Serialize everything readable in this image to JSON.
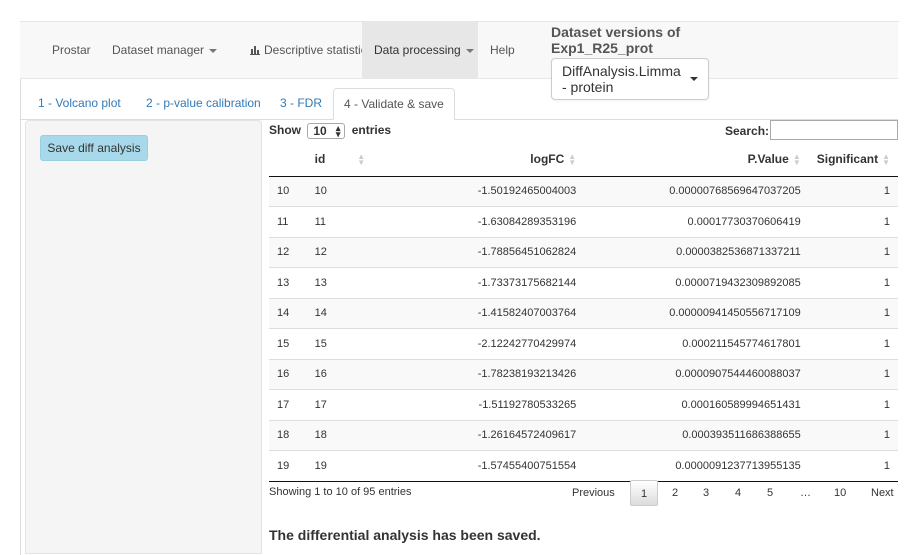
{
  "navbar": {
    "brand": "Prostar",
    "items": [
      "Dataset manager",
      "Descriptive statistics",
      "Data processing",
      "Help"
    ]
  },
  "dataset": {
    "title_line1": "Dataset versions of",
    "title_line2": "Exp1_R25_prot",
    "selected": "DiffAnalysis.Limma - protein"
  },
  "tabs": [
    "1 - Volcano plot",
    "2 - p-value calibration",
    "3 - FDR",
    "4 - Validate & save"
  ],
  "sidebar": {
    "save_button": "Save diff analysis"
  },
  "table": {
    "length_prefix": "Show",
    "length_value": "10",
    "length_suffix": "entries",
    "search_label": "Search:",
    "columns": [
      "",
      "id",
      "logFC",
      "P.Value",
      "Significant"
    ],
    "rows": [
      [
        "10",
        "10",
        "-1.50192465004003",
        "0.00000768569647037205",
        "1"
      ],
      [
        "11",
        "11",
        "-1.63084289353196",
        "0.00017730370606419",
        "1"
      ],
      [
        "12",
        "12",
        "-1.78856451062824",
        "0.0000382536871337211",
        "1"
      ],
      [
        "13",
        "13",
        "-1.73373175682144",
        "0.0000719432309892085",
        "1"
      ],
      [
        "14",
        "14",
        "-1.41582407003764",
        "0.00000941450556717109",
        "1"
      ],
      [
        "15",
        "15",
        "-2.12242770429974",
        "0.000211545774617801",
        "1"
      ],
      [
        "16",
        "16",
        "-1.78238193213426",
        "0.0000907544460088037",
        "1"
      ],
      [
        "17",
        "17",
        "-1.51192780533265",
        "0.000160589994651431",
        "1"
      ],
      [
        "18",
        "18",
        "-1.26164572409617",
        "0.000393511686388655",
        "1"
      ],
      [
        "19",
        "19",
        "-1.57455400751554",
        "0.0000091237713955135",
        "1"
      ]
    ],
    "info": "Showing 1 to 10 of 95 entries",
    "pagination": [
      "Previous",
      "1",
      "2",
      "3",
      "4",
      "5",
      "…",
      "10",
      "Next"
    ]
  },
  "message": "The differential analysis has been saved."
}
